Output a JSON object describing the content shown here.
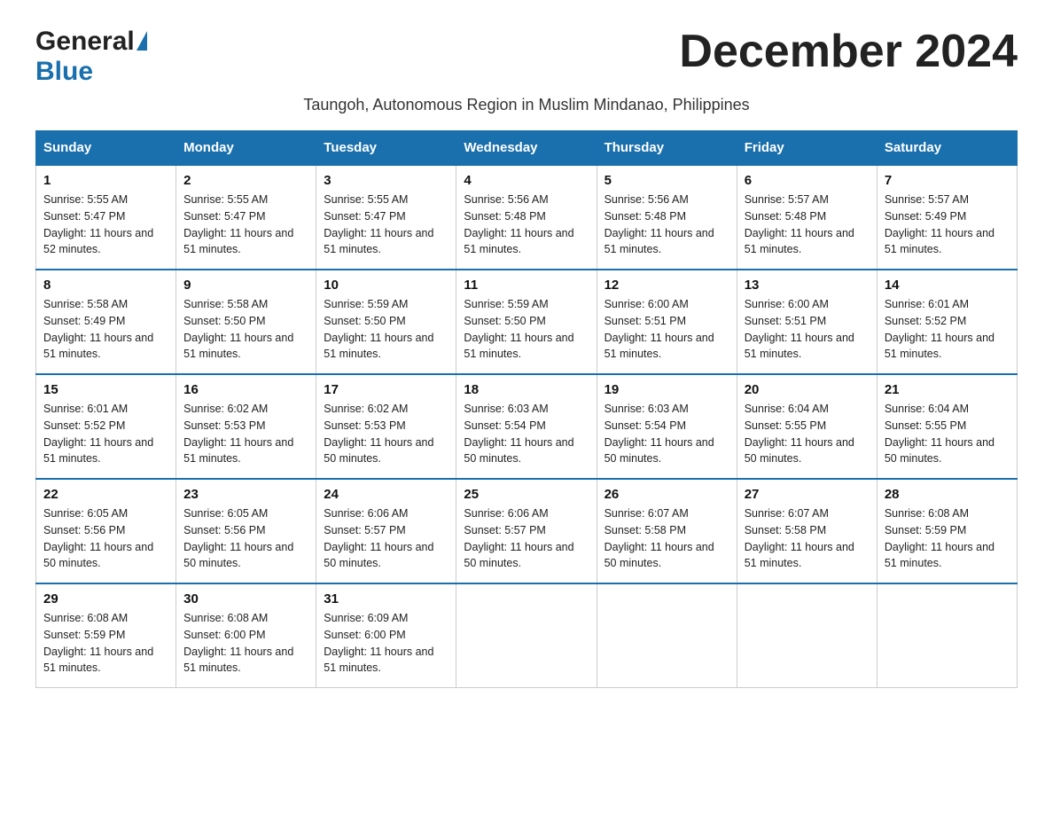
{
  "header": {
    "logo_general": "General",
    "logo_blue": "Blue",
    "month_title": "December 2024",
    "subtitle": "Taungoh, Autonomous Region in Muslim Mindanao, Philippines"
  },
  "weekdays": [
    "Sunday",
    "Monday",
    "Tuesday",
    "Wednesday",
    "Thursday",
    "Friday",
    "Saturday"
  ],
  "weeks": [
    [
      {
        "day": "1",
        "sunrise": "5:55 AM",
        "sunset": "5:47 PM",
        "daylight": "11 hours and 52 minutes."
      },
      {
        "day": "2",
        "sunrise": "5:55 AM",
        "sunset": "5:47 PM",
        "daylight": "11 hours and 51 minutes."
      },
      {
        "day": "3",
        "sunrise": "5:55 AM",
        "sunset": "5:47 PM",
        "daylight": "11 hours and 51 minutes."
      },
      {
        "day": "4",
        "sunrise": "5:56 AM",
        "sunset": "5:48 PM",
        "daylight": "11 hours and 51 minutes."
      },
      {
        "day": "5",
        "sunrise": "5:56 AM",
        "sunset": "5:48 PM",
        "daylight": "11 hours and 51 minutes."
      },
      {
        "day": "6",
        "sunrise": "5:57 AM",
        "sunset": "5:48 PM",
        "daylight": "11 hours and 51 minutes."
      },
      {
        "day": "7",
        "sunrise": "5:57 AM",
        "sunset": "5:49 PM",
        "daylight": "11 hours and 51 minutes."
      }
    ],
    [
      {
        "day": "8",
        "sunrise": "5:58 AM",
        "sunset": "5:49 PM",
        "daylight": "11 hours and 51 minutes."
      },
      {
        "day": "9",
        "sunrise": "5:58 AM",
        "sunset": "5:50 PM",
        "daylight": "11 hours and 51 minutes."
      },
      {
        "day": "10",
        "sunrise": "5:59 AM",
        "sunset": "5:50 PM",
        "daylight": "11 hours and 51 minutes."
      },
      {
        "day": "11",
        "sunrise": "5:59 AM",
        "sunset": "5:50 PM",
        "daylight": "11 hours and 51 minutes."
      },
      {
        "day": "12",
        "sunrise": "6:00 AM",
        "sunset": "5:51 PM",
        "daylight": "11 hours and 51 minutes."
      },
      {
        "day": "13",
        "sunrise": "6:00 AM",
        "sunset": "5:51 PM",
        "daylight": "11 hours and 51 minutes."
      },
      {
        "day": "14",
        "sunrise": "6:01 AM",
        "sunset": "5:52 PM",
        "daylight": "11 hours and 51 minutes."
      }
    ],
    [
      {
        "day": "15",
        "sunrise": "6:01 AM",
        "sunset": "5:52 PM",
        "daylight": "11 hours and 51 minutes."
      },
      {
        "day": "16",
        "sunrise": "6:02 AM",
        "sunset": "5:53 PM",
        "daylight": "11 hours and 51 minutes."
      },
      {
        "day": "17",
        "sunrise": "6:02 AM",
        "sunset": "5:53 PM",
        "daylight": "11 hours and 50 minutes."
      },
      {
        "day": "18",
        "sunrise": "6:03 AM",
        "sunset": "5:54 PM",
        "daylight": "11 hours and 50 minutes."
      },
      {
        "day": "19",
        "sunrise": "6:03 AM",
        "sunset": "5:54 PM",
        "daylight": "11 hours and 50 minutes."
      },
      {
        "day": "20",
        "sunrise": "6:04 AM",
        "sunset": "5:55 PM",
        "daylight": "11 hours and 50 minutes."
      },
      {
        "day": "21",
        "sunrise": "6:04 AM",
        "sunset": "5:55 PM",
        "daylight": "11 hours and 50 minutes."
      }
    ],
    [
      {
        "day": "22",
        "sunrise": "6:05 AM",
        "sunset": "5:56 PM",
        "daylight": "11 hours and 50 minutes."
      },
      {
        "day": "23",
        "sunrise": "6:05 AM",
        "sunset": "5:56 PM",
        "daylight": "11 hours and 50 minutes."
      },
      {
        "day": "24",
        "sunrise": "6:06 AM",
        "sunset": "5:57 PM",
        "daylight": "11 hours and 50 minutes."
      },
      {
        "day": "25",
        "sunrise": "6:06 AM",
        "sunset": "5:57 PM",
        "daylight": "11 hours and 50 minutes."
      },
      {
        "day": "26",
        "sunrise": "6:07 AM",
        "sunset": "5:58 PM",
        "daylight": "11 hours and 50 minutes."
      },
      {
        "day": "27",
        "sunrise": "6:07 AM",
        "sunset": "5:58 PM",
        "daylight": "11 hours and 51 minutes."
      },
      {
        "day": "28",
        "sunrise": "6:08 AM",
        "sunset": "5:59 PM",
        "daylight": "11 hours and 51 minutes."
      }
    ],
    [
      {
        "day": "29",
        "sunrise": "6:08 AM",
        "sunset": "5:59 PM",
        "daylight": "11 hours and 51 minutes."
      },
      {
        "day": "30",
        "sunrise": "6:08 AM",
        "sunset": "6:00 PM",
        "daylight": "11 hours and 51 minutes."
      },
      {
        "day": "31",
        "sunrise": "6:09 AM",
        "sunset": "6:00 PM",
        "daylight": "11 hours and 51 minutes."
      },
      null,
      null,
      null,
      null
    ]
  ]
}
